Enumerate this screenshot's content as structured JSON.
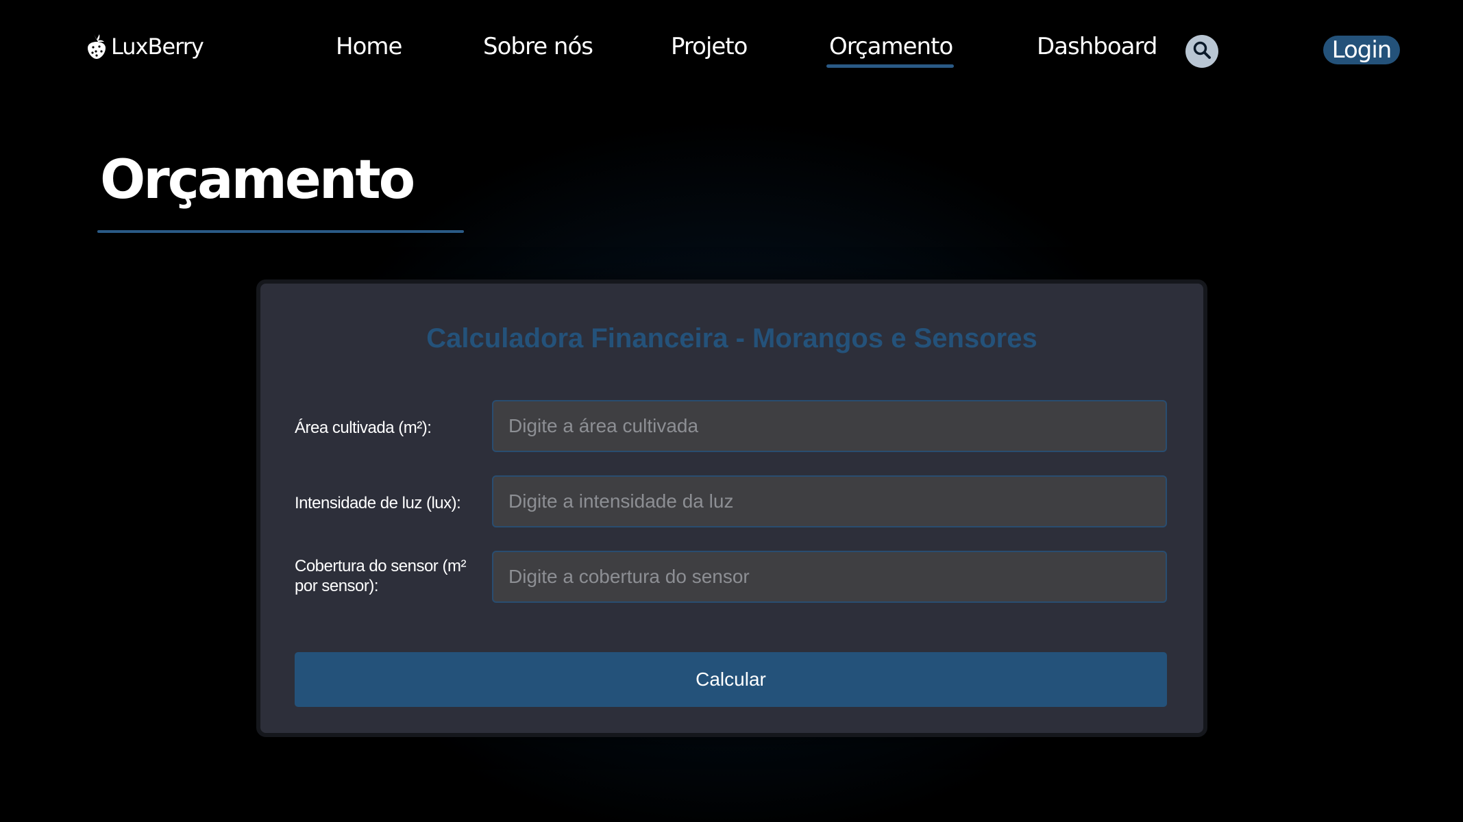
{
  "brand": {
    "name": "LuxBerry",
    "icon": "strawberry-icon"
  },
  "nav": {
    "items": [
      {
        "label": "Home"
      },
      {
        "label": "Sobre nós"
      },
      {
        "label": "Projeto"
      },
      {
        "label": "Orçamento",
        "active": true
      },
      {
        "label": "Dashboard"
      }
    ],
    "search_icon": "search-icon",
    "login_label": "Login"
  },
  "page": {
    "title": "Orçamento"
  },
  "calculator": {
    "title": "Calculadora Financeira - Morangos e Sensores",
    "fields": [
      {
        "label": "Área cultivada (m²):",
        "value": "",
        "placeholder": "Digite a área cultivada"
      },
      {
        "label": "Intensidade de luz (lux):",
        "value": "",
        "placeholder": "Digite a intensidade da luz"
      },
      {
        "label": "Cobertura do sensor (m² por sensor):",
        "value": "",
        "placeholder": "Digite a cobertura do sensor"
      }
    ],
    "submit_label": "Calcular"
  },
  "colors": {
    "accent": "#24527a",
    "card_background": "#2d2f3a",
    "input_background": "#3f3f42",
    "page_background": "#000000"
  }
}
